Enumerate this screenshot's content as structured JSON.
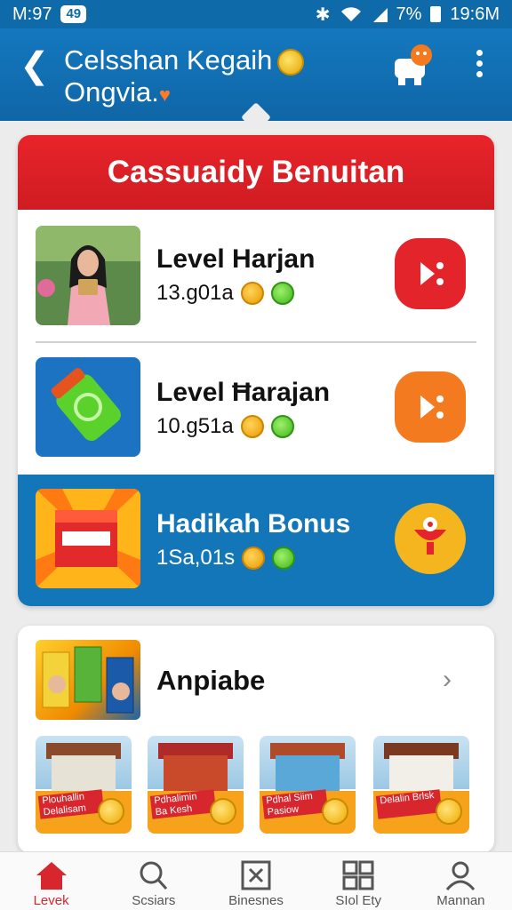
{
  "status_bar": {
    "time": "M:97",
    "pill": "49",
    "battery": "7%",
    "clock": "19:6M"
  },
  "header": {
    "title_line1": "Celsshan Kegaih",
    "title_line2": "Ongvia."
  },
  "main_card": {
    "banner": "Cassuaidy Benuitan",
    "rows": [
      {
        "name": "Level Harjan",
        "value": "13.g01a",
        "action_color": "#e3242b"
      },
      {
        "name": "Level Ħarajan",
        "value": "10.g51a",
        "action_color": "#f47a1f"
      },
      {
        "name": "Hadikah Bonus",
        "value": "1Sa,01s",
        "action_color": "#f5b51e"
      }
    ]
  },
  "section": {
    "heading": "Anpiabe",
    "tiles": [
      {
        "tag": "Plouhallin Delalisam"
      },
      {
        "tag": "Pdhalimin Ba Kesh"
      },
      {
        "tag": "Pdhal Siim Pasiow"
      },
      {
        "tag": "Delalin Brlsk"
      }
    ]
  },
  "nav": {
    "items": [
      {
        "label": "Levek",
        "icon": "home-icon"
      },
      {
        "label": "Scsiars",
        "icon": "search-icon"
      },
      {
        "label": "Binesnes",
        "icon": "business-icon"
      },
      {
        "label": "SIol Ety",
        "icon": "grid-icon"
      },
      {
        "label": "Mannan",
        "icon": "profile-icon"
      }
    ]
  },
  "colors": {
    "primary_blue": "#1276b9",
    "banner_red": "#e3242b",
    "accent_orange": "#f47a1f"
  }
}
